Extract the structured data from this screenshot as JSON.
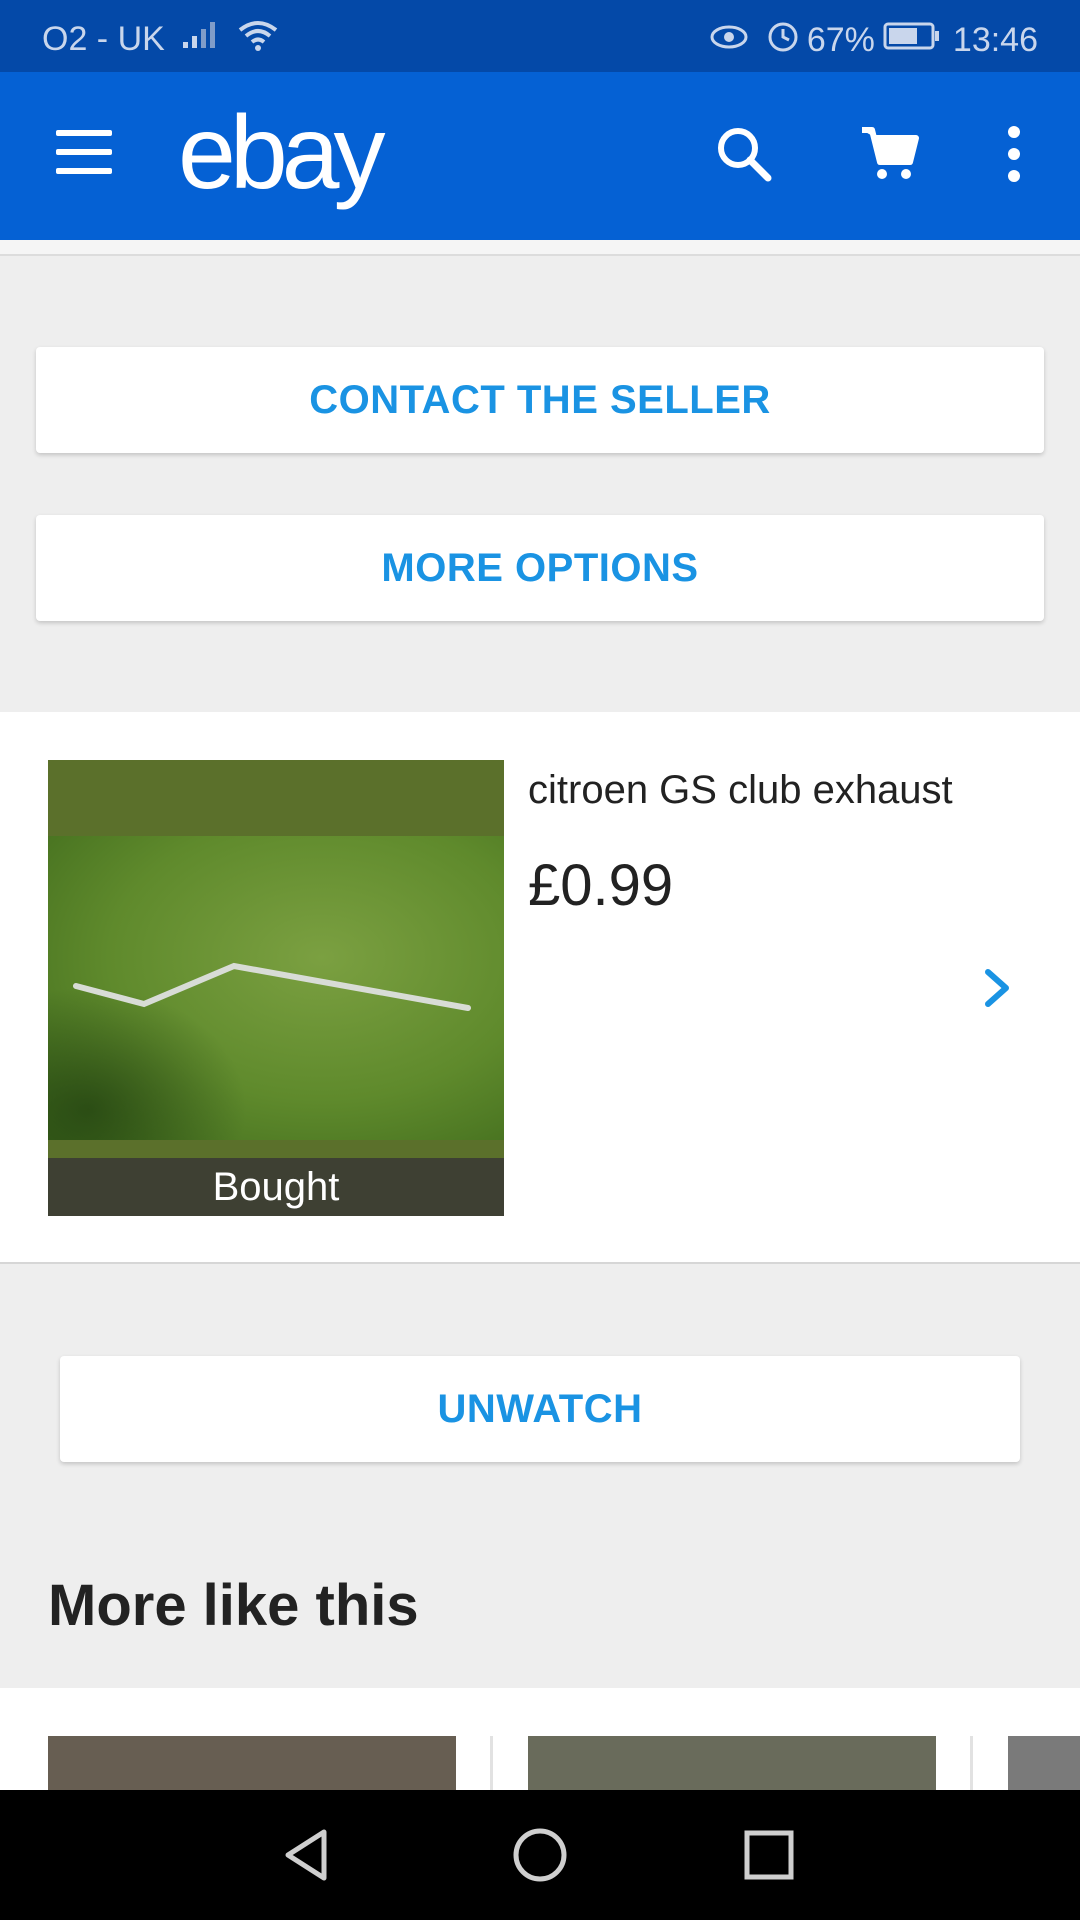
{
  "status_bar": {
    "carrier": "O2 - UK",
    "battery": "67%",
    "time": "13:46"
  },
  "app_bar": {
    "logo": "ebay"
  },
  "actions": {
    "contact_seller": "CONTACT THE SELLER",
    "more_options": "MORE OPTIONS",
    "unwatch": "UNWATCH"
  },
  "item": {
    "title": "citroen GS club exhaust",
    "price": "£0.99",
    "badge": "Bought"
  },
  "more_like_this": {
    "title": "More like this"
  },
  "colors": {
    "status_bar": "#0449a8",
    "app_bar": "#0561d4",
    "accent": "#1a93e3",
    "background": "#eeeeee"
  }
}
